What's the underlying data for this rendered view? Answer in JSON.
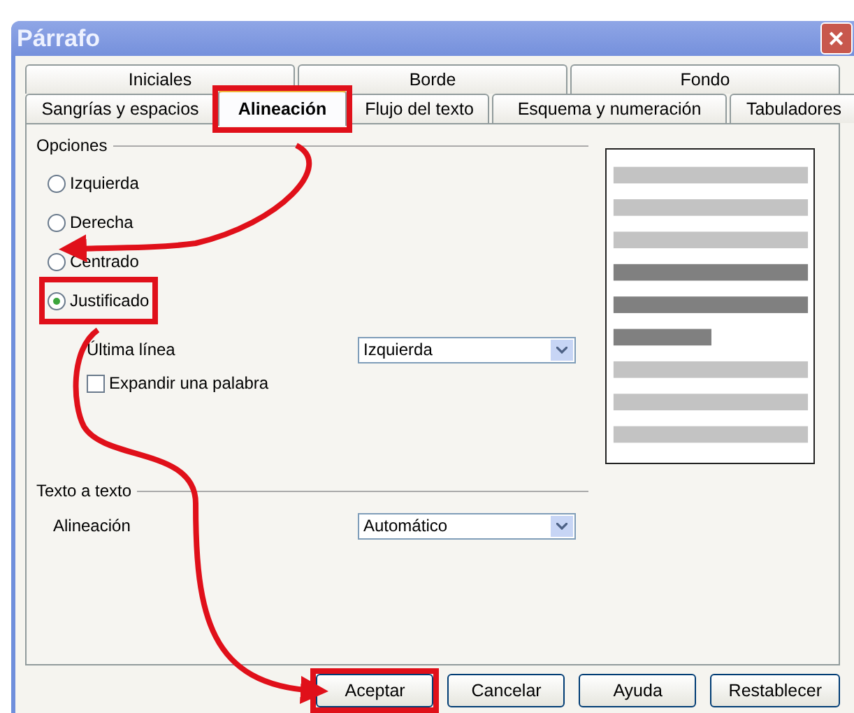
{
  "window": {
    "title": "Párrafo",
    "close": "✕"
  },
  "tab_rows": [
    {
      "tabs": [
        {
          "label": "Iniciales",
          "selected": false,
          "highlighted": false
        },
        {
          "label": "Borde",
          "selected": false,
          "highlighted": false
        },
        {
          "label": "Fondo",
          "selected": false,
          "highlighted": false
        }
      ]
    },
    {
      "tabs": [
        {
          "label": "Sangrías y espacios",
          "selected": false,
          "highlighted": false
        },
        {
          "label": "Alineación",
          "selected": true,
          "highlighted": true
        },
        {
          "label": "Flujo del texto",
          "selected": false,
          "highlighted": false
        },
        {
          "label": "Esquema y numeración",
          "selected": false,
          "highlighted": false
        },
        {
          "label": "Tabuladores",
          "selected": false,
          "highlighted": false
        }
      ]
    }
  ],
  "options": {
    "legend": "Opciones",
    "alignments": [
      {
        "label": "Izquierda",
        "selected": false,
        "highlighted": false
      },
      {
        "label": "Derecha",
        "selected": false,
        "highlighted": false
      },
      {
        "label": "Centrado",
        "selected": false,
        "highlighted": false
      },
      {
        "label": "Justificado",
        "selected": true,
        "highlighted": true
      }
    ],
    "last_line": {
      "label": "Última línea",
      "value": "Izquierda"
    },
    "expand_word": {
      "label": "Expandir una palabra",
      "checked": false
    }
  },
  "text_to_text": {
    "legend": "Texto a texto",
    "alignment": {
      "label": "Alineación",
      "value": "Automático"
    }
  },
  "buttons": [
    {
      "label": "Aceptar",
      "highlighted": true
    },
    {
      "label": "Cancelar",
      "highlighted": false
    },
    {
      "label": "Ayuda",
      "highlighted": false
    },
    {
      "label": "Restablecer",
      "highlighted": false
    }
  ]
}
